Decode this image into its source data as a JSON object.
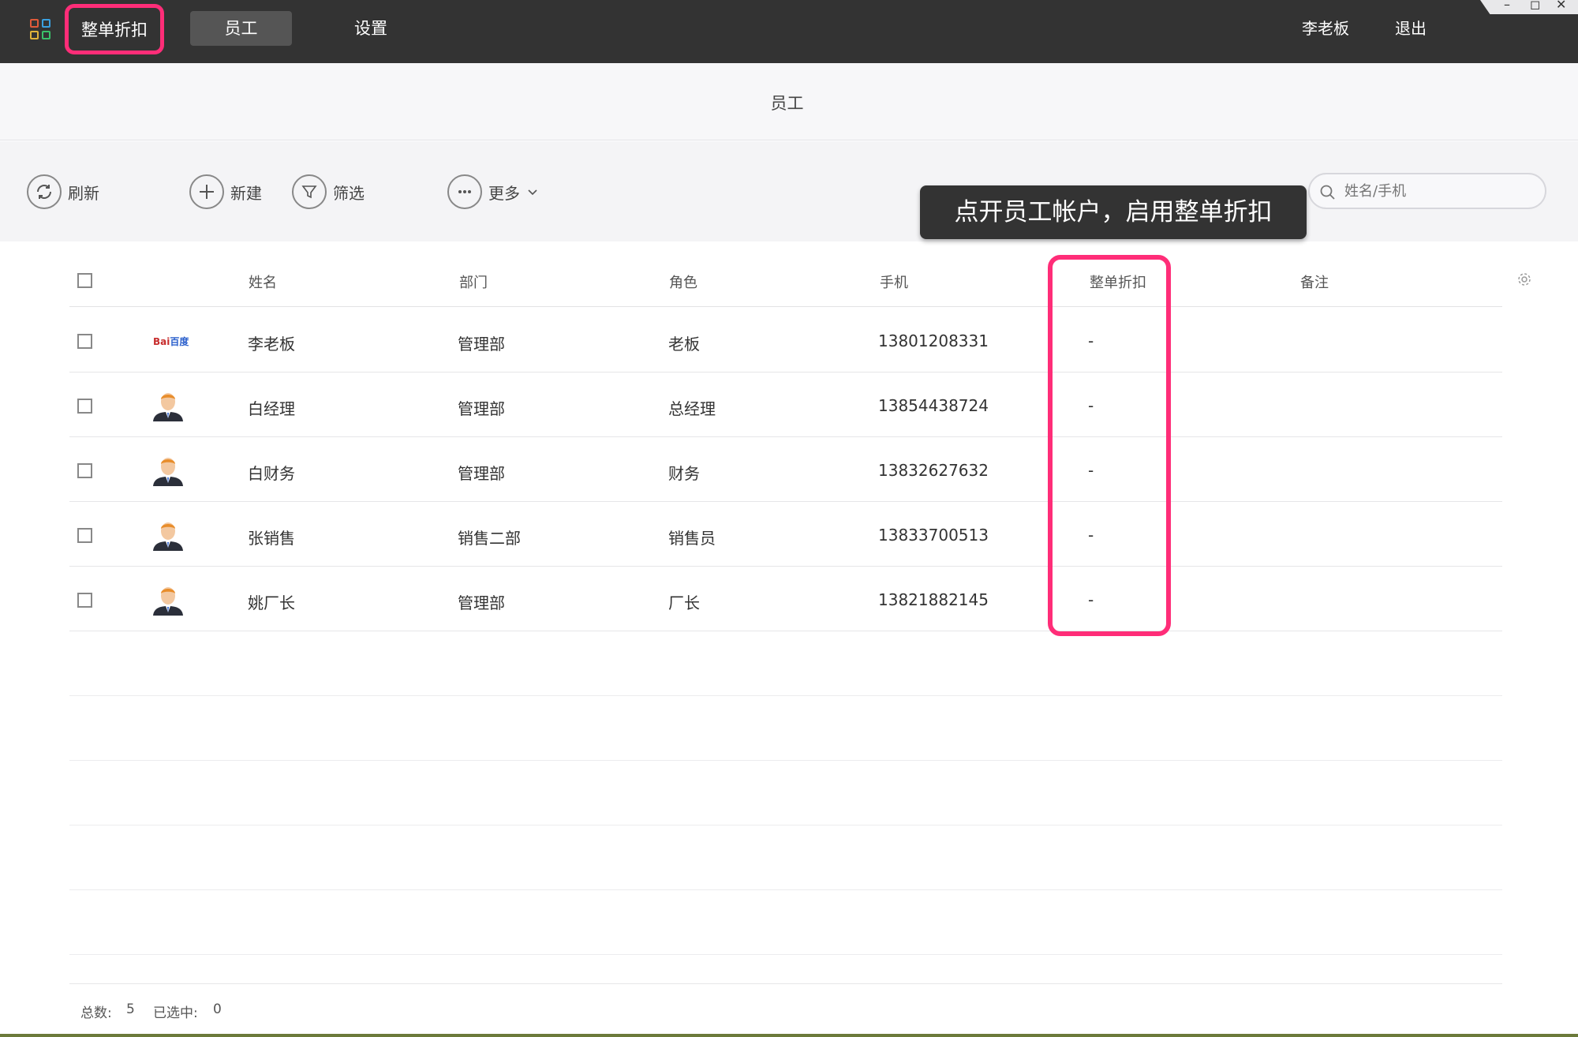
{
  "topbar": {
    "tabs": [
      {
        "label": "整单折扣"
      },
      {
        "label": "员工"
      },
      {
        "label": "设置"
      }
    ],
    "user": "李老板",
    "logout": "退出",
    "window_controls": {
      "minimize": "–",
      "maximize": "◻",
      "close": "✕"
    }
  },
  "page": {
    "title": "员工"
  },
  "toolbar": {
    "refresh": "刷新",
    "new": "新建",
    "filter": "筛选",
    "more": "更多",
    "search_placeholder": "姓名/手机"
  },
  "tooltip": "点开员工帐户，启用整单折扣",
  "table": {
    "columns": [
      "姓名",
      "部门",
      "角色",
      "手机",
      "整单折扣",
      "备注"
    ],
    "rows": [
      {
        "name": "李老板",
        "dept": "管理部",
        "role": "老板",
        "phone": "13801208331",
        "discount": "-",
        "note": "",
        "avatar": "baidu-logo"
      },
      {
        "name": "白经理",
        "dept": "管理部",
        "role": "总经理",
        "phone": "13854438724",
        "discount": "-",
        "note": "",
        "avatar": "person-avatar"
      },
      {
        "name": "白财务",
        "dept": "管理部",
        "role": "财务",
        "phone": "13832627632",
        "discount": "-",
        "note": "",
        "avatar": "person-avatar"
      },
      {
        "name": "张销售",
        "dept": "销售二部",
        "role": "销售员",
        "phone": "13833700513",
        "discount": "-",
        "note": "",
        "avatar": "person-avatar"
      },
      {
        "name": "姚厂长",
        "dept": "管理部",
        "role": "厂长",
        "phone": "13821882145",
        "discount": "-",
        "note": "",
        "avatar": "person-avatar"
      }
    ]
  },
  "footer": {
    "total_label": "总数:",
    "total": "5",
    "selected_label": "已选中:",
    "selected": "0"
  },
  "baidu_logo": {
    "text_a": "Bai",
    "text_b": "百度"
  },
  "colors": {
    "highlight": "#ff2d78",
    "topbar": "#333333"
  }
}
